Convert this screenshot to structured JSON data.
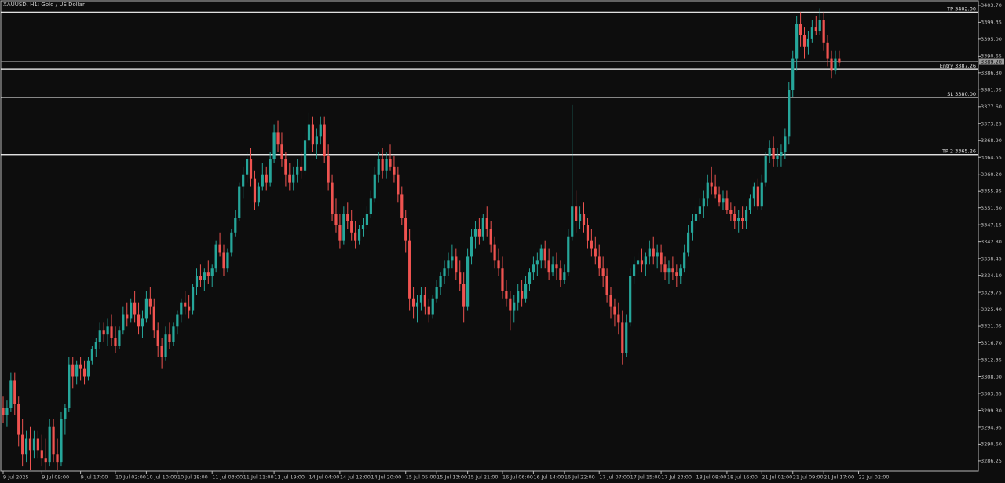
{
  "chart_data": {
    "type": "candlestick",
    "title": "XAUUSD, H1:  Gold / US Dollar",
    "colors": {
      "background": "#0d0d0d",
      "up": "#26a69a",
      "down": "#ef5350",
      "frame": "#b8b8b8",
      "text": "#bdbdbd",
      "level": "#ffffff"
    },
    "ylim": [
      3283.6,
      3404.9
    ],
    "y_ticks": [
      "3403.70",
      "3399.35",
      "3395.00",
      "3390.65",
      "3386.30",
      "3381.95",
      "3377.60",
      "3373.25",
      "3368.90",
      "3364.55",
      "3360.20",
      "3355.85",
      "3351.50",
      "3347.15",
      "3342.80",
      "3338.45",
      "3334.10",
      "3329.75",
      "3325.40",
      "3321.05",
      "3316.70",
      "3312.35",
      "3308.00",
      "3303.65",
      "3299.30",
      "3294.95",
      "3290.60",
      "3286.25"
    ],
    "x_ticks": [
      {
        "bar": 0,
        "label": "9 Jul 2025"
      },
      {
        "bar": 10,
        "label": "9 Jul 09:00"
      },
      {
        "bar": 20,
        "label": "9 Jul 17:00"
      },
      {
        "bar": 29,
        "label": "10 Jul 02:00"
      },
      {
        "bar": 37,
        "label": "10 Jul 10:00"
      },
      {
        "bar": 45,
        "label": "10 Jul 18:00"
      },
      {
        "bar": 54,
        "label": "11 Jul 03:00"
      },
      {
        "bar": 62,
        "label": "11 Jul 11:00"
      },
      {
        "bar": 70,
        "label": "11 Jul 19:00"
      },
      {
        "bar": 79,
        "label": "14 Jul 04:00"
      },
      {
        "bar": 87,
        "label": "14 Jul 12:00"
      },
      {
        "bar": 95,
        "label": "14 Jul 20:00"
      },
      {
        "bar": 104,
        "label": "15 Jul 05:00"
      },
      {
        "bar": 112,
        "label": "15 Jul 13:00"
      },
      {
        "bar": 120,
        "label": "15 Jul 21:00"
      },
      {
        "bar": 129,
        "label": "16 Jul 06:00"
      },
      {
        "bar": 137,
        "label": "16 Jul 14:00"
      },
      {
        "bar": 145,
        "label": "16 Jul 22:00"
      },
      {
        "bar": 154,
        "label": "17 Jul 07:00"
      },
      {
        "bar": 162,
        "label": "17 Jul 15:00"
      },
      {
        "bar": 170,
        "label": "17 Jul 23:00"
      },
      {
        "bar": 179,
        "label": "18 Jul 08:00"
      },
      {
        "bar": 187,
        "label": "18 Jul 16:00"
      },
      {
        "bar": 196,
        "label": "21 Jul 01:00"
      },
      {
        "bar": 204,
        "label": "21 Jul 09:00"
      },
      {
        "bar": 212,
        "label": "21 Jul 17:00"
      },
      {
        "bar": 221,
        "label": "22 Jul 02:00"
      }
    ],
    "levels": [
      {
        "label": "TP 3402.00",
        "value": 3402.0
      },
      {
        "label": "",
        "value": 3389.2,
        "kind": "bid"
      },
      {
        "label": "Entry 3387.26",
        "value": 3387.26
      },
      {
        "label": "SL 3380.00",
        "value": 3380.0
      },
      {
        "label": "TP 2 3365.26",
        "value": 3365.26
      }
    ],
    "current_price": "3389.20",
    "ohlc": [
      [
        3300,
        3303,
        3296,
        3298
      ],
      [
        3298,
        3302,
        3295,
        3300
      ],
      [
        3300,
        3309,
        3299,
        3307
      ],
      [
        3307,
        3309,
        3298,
        3301
      ],
      [
        3301,
        3303,
        3290,
        3293
      ],
      [
        3293,
        3297,
        3285,
        3288
      ],
      [
        3288,
        3294,
        3286,
        3292
      ],
      [
        3292,
        3295,
        3284,
        3289
      ],
      [
        3289,
        3294,
        3287,
        3292
      ],
      [
        3292,
        3294,
        3287,
        3289
      ],
      [
        3289,
        3293,
        3285,
        3287
      ],
      [
        3287,
        3292,
        3284,
        3286
      ],
      [
        3286,
        3297,
        3285,
        3295
      ],
      [
        3295,
        3297,
        3286,
        3288
      ],
      [
        3288,
        3292,
        3284,
        3286
      ],
      [
        3286,
        3299,
        3285,
        3297
      ],
      [
        3297,
        3301,
        3293,
        3300
      ],
      [
        3300,
        3313,
        3299,
        3311
      ],
      [
        3311,
        3313,
        3305,
        3308
      ],
      [
        3308,
        3312,
        3306,
        3311
      ],
      [
        3311,
        3313,
        3307,
        3310
      ],
      [
        3310,
        3312,
        3306,
        3308
      ],
      [
        3308,
        3313,
        3307,
        3312
      ],
      [
        3312,
        3316,
        3311,
        3315
      ],
      [
        3315,
        3318,
        3313,
        3317
      ],
      [
        3317,
        3322,
        3315,
        3320
      ],
      [
        3320,
        3322,
        3317,
        3319
      ],
      [
        3319,
        3323,
        3316,
        3321
      ],
      [
        3321,
        3324,
        3316,
        3318
      ],
      [
        3318,
        3321,
        3314,
        3316
      ],
      [
        3316,
        3321,
        3315,
        3320
      ],
      [
        3320,
        3326,
        3319,
        3324
      ],
      [
        3324,
        3327,
        3321,
        3323
      ],
      [
        3323,
        3328,
        3322,
        3327
      ],
      [
        3327,
        3330,
        3322,
        3324
      ],
      [
        3324,
        3327,
        3319,
        3321
      ],
      [
        3321,
        3325,
        3318,
        3323
      ],
      [
        3323,
        3330,
        3322,
        3328
      ],
      [
        3328,
        3331,
        3324,
        3326
      ],
      [
        3326,
        3328,
        3318,
        3320
      ],
      [
        3320,
        3322,
        3313,
        3316
      ],
      [
        3316,
        3318,
        3310,
        3313
      ],
      [
        3313,
        3321,
        3312,
        3319
      ],
      [
        3319,
        3322,
        3315,
        3317
      ],
      [
        3317,
        3322,
        3316,
        3321
      ],
      [
        3321,
        3325,
        3319,
        3324
      ],
      [
        3324,
        3328,
        3322,
        3327
      ],
      [
        3327,
        3330,
        3324,
        3326
      ],
      [
        3326,
        3329,
        3323,
        3325
      ],
      [
        3325,
        3332,
        3324,
        3331
      ],
      [
        3331,
        3336,
        3329,
        3334
      ],
      [
        3334,
        3337,
        3331,
        3333
      ],
      [
        3333,
        3336,
        3330,
        3335
      ],
      [
        3335,
        3338,
        3332,
        3334
      ],
      [
        3334,
        3337,
        3331,
        3336
      ],
      [
        3336,
        3343,
        3335,
        3342
      ],
      [
        3342,
        3345,
        3339,
        3340
      ],
      [
        3340,
        3342,
        3334,
        3336
      ],
      [
        3336,
        3341,
        3335,
        3340
      ],
      [
        3340,
        3346,
        3339,
        3345
      ],
      [
        3345,
        3351,
        3344,
        3349
      ],
      [
        3349,
        3358,
        3348,
        3357
      ],
      [
        3357,
        3362,
        3354,
        3360
      ],
      [
        3360,
        3366,
        3358,
        3364
      ],
      [
        3364,
        3367,
        3357,
        3359
      ],
      [
        3359,
        3361,
        3351,
        3353
      ],
      [
        3353,
        3358,
        3352,
        3357
      ],
      [
        3357,
        3363,
        3356,
        3360
      ],
      [
        3360,
        3362,
        3356,
        3358
      ],
      [
        3358,
        3366,
        3357,
        3364
      ],
      [
        3364,
        3373,
        3363,
        3371
      ],
      [
        3371,
        3374,
        3366,
        3368
      ],
      [
        3368,
        3371,
        3362,
        3364
      ],
      [
        3364,
        3366,
        3357,
        3360
      ],
      [
        3360,
        3363,
        3356,
        3358
      ],
      [
        3358,
        3362,
        3356,
        3360
      ],
      [
        3360,
        3364,
        3358,
        3362
      ],
      [
        3362,
        3366,
        3359,
        3361
      ],
      [
        3361,
        3371,
        3360,
        3369
      ],
      [
        3369,
        3376,
        3367,
        3373
      ],
      [
        3373,
        3375,
        3366,
        3368
      ],
      [
        3368,
        3372,
        3364,
        3370
      ],
      [
        3370,
        3375,
        3368,
        3373
      ],
      [
        3373,
        3375,
        3363,
        3365
      ],
      [
        3365,
        3368,
        3356,
        3358
      ],
      [
        3358,
        3360,
        3348,
        3350
      ],
      [
        3350,
        3354,
        3345,
        3347
      ],
      [
        3347,
        3350,
        3341,
        3343
      ],
      [
        3343,
        3352,
        3342,
        3350
      ],
      [
        3350,
        3353,
        3346,
        3348
      ],
      [
        3348,
        3351,
        3343,
        3345
      ],
      [
        3345,
        3348,
        3341,
        3343
      ],
      [
        3343,
        3347,
        3342,
        3346
      ],
      [
        3346,
        3349,
        3344,
        3347
      ],
      [
        3347,
        3352,
        3346,
        3350
      ],
      [
        3350,
        3356,
        3349,
        3354
      ],
      [
        3354,
        3362,
        3353,
        3360
      ],
      [
        3360,
        3366,
        3358,
        3364
      ],
      [
        3364,
        3367,
        3359,
        3361
      ],
      [
        3361,
        3366,
        3359,
        3364
      ],
      [
        3364,
        3368,
        3361,
        3362
      ],
      [
        3362,
        3365,
        3358,
        3360
      ],
      [
        3360,
        3362,
        3353,
        3355
      ],
      [
        3355,
        3357,
        3347,
        3349
      ],
      [
        3349,
        3351,
        3340,
        3343
      ],
      [
        3343,
        3346,
        3325,
        3328
      ],
      [
        3328,
        3331,
        3323,
        3326
      ],
      [
        3326,
        3329,
        3322,
        3327
      ],
      [
        3327,
        3331,
        3325,
        3329
      ],
      [
        3329,
        3331,
        3324,
        3326
      ],
      [
        3326,
        3328,
        3322,
        3324
      ],
      [
        3324,
        3329,
        3323,
        3328
      ],
      [
        3328,
        3333,
        3327,
        3331
      ],
      [
        3331,
        3335,
        3329,
        3334
      ],
      [
        3334,
        3338,
        3332,
        3336
      ],
      [
        3336,
        3340,
        3334,
        3338
      ],
      [
        3338,
        3342,
        3336,
        3339
      ],
      [
        3339,
        3341,
        3333,
        3335
      ],
      [
        3335,
        3338,
        3330,
        3332
      ],
      [
        3332,
        3335,
        3322,
        3326
      ],
      [
        3326,
        3341,
        3325,
        3339
      ],
      [
        3339,
        3346,
        3337,
        3344
      ],
      [
        3344,
        3348,
        3341,
        3346
      ],
      [
        3346,
        3349,
        3342,
        3344
      ],
      [
        3344,
        3350,
        3343,
        3349
      ],
      [
        3349,
        3352,
        3344,
        3346
      ],
      [
        3346,
        3348,
        3340,
        3342
      ],
      [
        3342,
        3344,
        3336,
        3338
      ],
      [
        3338,
        3341,
        3334,
        3336
      ],
      [
        3336,
        3339,
        3328,
        3330
      ],
      [
        3330,
        3333,
        3326,
        3328
      ],
      [
        3328,
        3330,
        3320,
        3325
      ],
      [
        3325,
        3329,
        3322,
        3327
      ],
      [
        3327,
        3332,
        3325,
        3330
      ],
      [
        3330,
        3333,
        3326,
        3328
      ],
      [
        3328,
        3334,
        3327,
        3332
      ],
      [
        3332,
        3336,
        3330,
        3335
      ],
      [
        3335,
        3339,
        3333,
        3337
      ],
      [
        3337,
        3340,
        3334,
        3338
      ],
      [
        3338,
        3342,
        3336,
        3341
      ],
      [
        3341,
        3343,
        3336,
        3338
      ],
      [
        3338,
        3341,
        3333,
        3335
      ],
      [
        3335,
        3339,
        3334,
        3337
      ],
      [
        3337,
        3340,
        3333,
        3336
      ],
      [
        3336,
        3338,
        3331,
        3333
      ],
      [
        3333,
        3337,
        3332,
        3335
      ],
      [
        3335,
        3346,
        3334,
        3344
      ],
      [
        3344,
        3378,
        3343,
        3352
      ],
      [
        3352,
        3356,
        3345,
        3348
      ],
      [
        3348,
        3352,
        3346,
        3350
      ],
      [
        3350,
        3353,
        3345,
        3347
      ],
      [
        3347,
        3349,
        3341,
        3343
      ],
      [
        3343,
        3346,
        3339,
        3341
      ],
      [
        3341,
        3344,
        3337,
        3339
      ],
      [
        3339,
        3342,
        3334,
        3336
      ],
      [
        3336,
        3339,
        3331,
        3334
      ],
      [
        3334,
        3336,
        3327,
        3329
      ],
      [
        3329,
        3331,
        3323,
        3326
      ],
      [
        3326,
        3328,
        3321,
        3324
      ],
      [
        3324,
        3327,
        3319,
        3322
      ],
      [
        3322,
        3325,
        3311,
        3314
      ],
      [
        3314,
        3324,
        3313,
        3322
      ],
      [
        3322,
        3336,
        3321,
        3334
      ],
      [
        3334,
        3339,
        3332,
        3337
      ],
      [
        3337,
        3340,
        3334,
        3338
      ],
      [
        3338,
        3341,
        3335,
        3337
      ],
      [
        3337,
        3340,
        3334,
        3339
      ],
      [
        3339,
        3343,
        3337,
        3341
      ],
      [
        3341,
        3344,
        3337,
        3339
      ],
      [
        3339,
        3342,
        3336,
        3340
      ],
      [
        3340,
        3342,
        3335,
        3337
      ],
      [
        3337,
        3339,
        3333,
        3335
      ],
      [
        3335,
        3338,
        3332,
        3336
      ],
      [
        3336,
        3339,
        3333,
        3335
      ],
      [
        3335,
        3337,
        3331,
        3334
      ],
      [
        3334,
        3337,
        3332,
        3336
      ],
      [
        3336,
        3342,
        3335,
        3340
      ],
      [
        3340,
        3347,
        3339,
        3345
      ],
      [
        3345,
        3350,
        3343,
        3348
      ],
      [
        3348,
        3352,
        3346,
        3350
      ],
      [
        3350,
        3354,
        3348,
        3352
      ],
      [
        3352,
        3356,
        3349,
        3354
      ],
      [
        3354,
        3360,
        3352,
        3358
      ],
      [
        3358,
        3362,
        3355,
        3357
      ],
      [
        3357,
        3360,
        3354,
        3355
      ],
      [
        3355,
        3357,
        3352,
        3353
      ],
      [
        3353,
        3356,
        3351,
        3354
      ],
      [
        3354,
        3356,
        3350,
        3351
      ],
      [
        3351,
        3353,
        3348,
        3350
      ],
      [
        3350,
        3352,
        3346,
        3348
      ],
      [
        3348,
        3351,
        3345,
        3349
      ],
      [
        3349,
        3352,
        3346,
        3348
      ],
      [
        3348,
        3352,
        3346,
        3351
      ],
      [
        3351,
        3355,
        3350,
        3354
      ],
      [
        3354,
        3358,
        3352,
        3357
      ],
      [
        3357,
        3359,
        3351,
        3352
      ],
      [
        3352,
        3360,
        3351,
        3358
      ],
      [
        3358,
        3366,
        3357,
        3365
      ],
      [
        3365,
        3369,
        3363,
        3367
      ],
      [
        3367,
        3370,
        3362,
        3364
      ],
      [
        3364,
        3367,
        3362,
        3365
      ],
      [
        3365,
        3368,
        3362,
        3366
      ],
      [
        3366,
        3372,
        3364,
        3370
      ],
      [
        3370,
        3384,
        3368,
        3382
      ],
      [
        3382,
        3392,
        3380,
        3390
      ],
      [
        3390,
        3401,
        3387,
        3399
      ],
      [
        3399,
        3402,
        3393,
        3396
      ],
      [
        3396,
        3398,
        3390,
        3393
      ],
      [
        3393,
        3397,
        3391,
        3395
      ],
      [
        3395,
        3400,
        3394,
        3398
      ],
      [
        3398,
        3401,
        3396,
        3397
      ],
      [
        3397,
        3403,
        3396,
        3400
      ],
      [
        3400,
        3402,
        3392,
        3394
      ],
      [
        3394,
        3396,
        3388,
        3390
      ],
      [
        3390,
        3392,
        3385,
        3387
      ],
      [
        3387,
        3392,
        3386,
        3390
      ],
      [
        3390,
        3392,
        3388,
        3389
      ]
    ]
  }
}
